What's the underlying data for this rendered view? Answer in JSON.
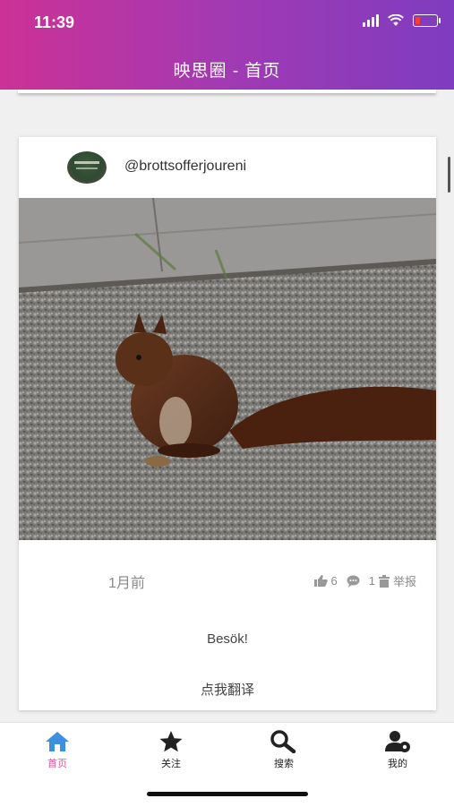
{
  "status_bar": {
    "time": "11:39"
  },
  "header": {
    "title": "映思圈 - 首页"
  },
  "post": {
    "username": "@brottsofferjoureni",
    "time_ago": "1月前",
    "likes": "6",
    "comments": "1",
    "report_label": "举报",
    "text": "Besök!",
    "translate_label": "点我翻译"
  },
  "tabs": [
    {
      "label": "首页",
      "icon": "home-icon",
      "active": true
    },
    {
      "label": "关注",
      "icon": "star-icon",
      "active": false
    },
    {
      "label": "搜索",
      "icon": "search-icon",
      "active": false
    },
    {
      "label": "我的",
      "icon": "user-settings-icon",
      "active": false
    }
  ],
  "colors": {
    "header_gradient_start": "#cc3196",
    "header_gradient_end": "#7e3cc0",
    "active_tab": "#e9539b",
    "active_tab_icon": "#3d8fe0"
  }
}
